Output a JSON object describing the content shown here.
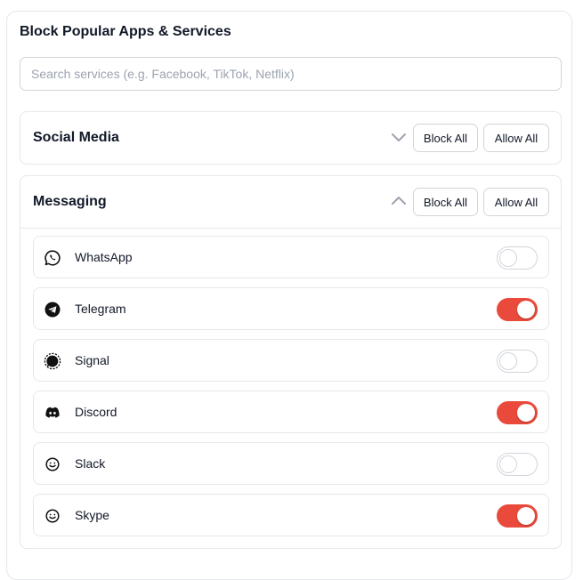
{
  "panel": {
    "title": "Block Popular Apps & Services"
  },
  "search": {
    "placeholder": "Search services (e.g. Facebook, TikTok, Netflix)",
    "value": ""
  },
  "categories": [
    {
      "name": "Social Media",
      "expanded": false,
      "chevron_icon": "chevron-down-icon",
      "block_all_label": "Block All",
      "allow_all_label": "Allow All"
    },
    {
      "name": "Messaging",
      "expanded": true,
      "chevron_icon": "chevron-up-icon",
      "block_all_label": "Block All",
      "allow_all_label": "Allow All",
      "services": [
        {
          "name": "WhatsApp",
          "icon": "whatsapp-icon",
          "blocked": false
        },
        {
          "name": "Telegram",
          "icon": "telegram-icon",
          "blocked": true
        },
        {
          "name": "Signal",
          "icon": "signal-icon",
          "blocked": false
        },
        {
          "name": "Discord",
          "icon": "discord-icon",
          "blocked": true
        },
        {
          "name": "Slack",
          "icon": "smiley-icon",
          "blocked": false
        },
        {
          "name": "Skype",
          "icon": "smiley-icon",
          "blocked": true
        }
      ]
    }
  ],
  "colors": {
    "toggle_on": "#ea4a3c",
    "border": "#e5e7eb",
    "text": "#111827",
    "placeholder": "#9ca3af"
  }
}
